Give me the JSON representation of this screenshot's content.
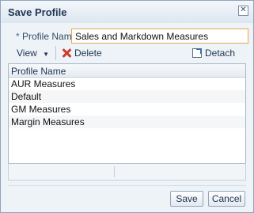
{
  "dialog": {
    "title": "Save Profile"
  },
  "form": {
    "required_marker": "*",
    "profile_name_label": "Profile Name",
    "profile_name_value": "Sales and Markdown Measures"
  },
  "toolbar": {
    "view_label": "View",
    "delete_label": "Delete",
    "detach_label": "Detach"
  },
  "table": {
    "header": "Profile Name",
    "rows": [
      "AUR Measures",
      "Default",
      "GM Measures",
      "Margin Measures"
    ]
  },
  "buttons": {
    "save": "Save",
    "cancel": "Cancel"
  }
}
